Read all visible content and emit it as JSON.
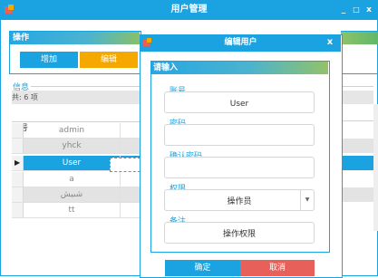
{
  "window": {
    "title": "用户管理",
    "minimize": "_",
    "maximize": "□",
    "close": "x"
  },
  "operation": {
    "title": "操作",
    "add_label": "增加",
    "edit_label": "编辑"
  },
  "info": {
    "title": "信息",
    "count": "共: 6 项"
  },
  "grid": {
    "column_header": "账号",
    "rows": [
      "admin",
      "yhck",
      "User",
      "a",
      "شىيش",
      "tt"
    ],
    "selected_index": 2
  },
  "dialog": {
    "title": "编辑用户",
    "close": "x",
    "group_title": "请输入",
    "fields": {
      "account": {
        "label": "账号",
        "value": "User"
      },
      "password": {
        "label": "密码",
        "value": ""
      },
      "confirm_password": {
        "label": "确认密码",
        "value": ""
      },
      "role": {
        "label": "权限",
        "value": "操作员"
      },
      "remark": {
        "label": "备注",
        "value": "操作权限"
      }
    },
    "ok_label": "确定",
    "cancel_label": "取消"
  },
  "colors": {
    "accent": "#1aa3e0",
    "warning": "#f4a800",
    "danger": "#e8605a"
  }
}
